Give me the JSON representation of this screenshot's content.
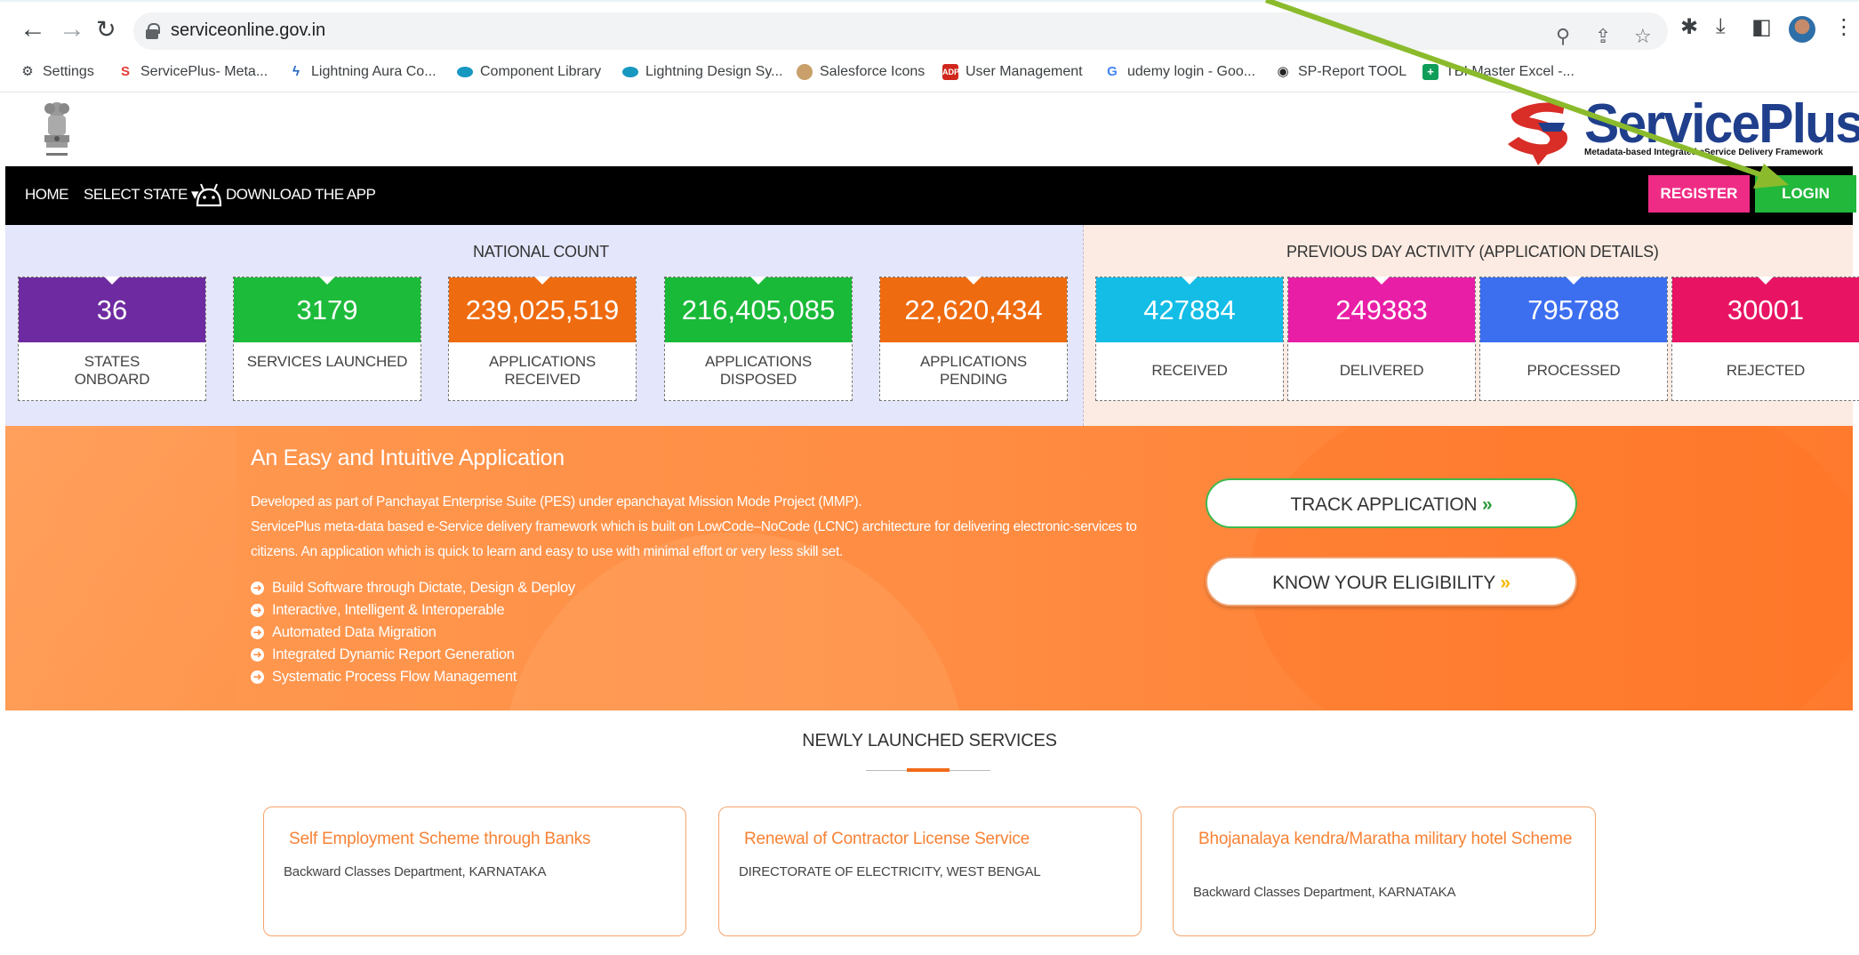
{
  "browser": {
    "url": "serviceonline.gov.in",
    "bookmarks": [
      {
        "label": "Settings",
        "icon": "gear-icon"
      },
      {
        "label": "ServicePlus- Meta...",
        "icon": "serviceplus-icon"
      },
      {
        "label": "Lightning Aura Co...",
        "icon": "lightning-icon"
      },
      {
        "label": "Component Library",
        "icon": "salesforce-cloud-icon"
      },
      {
        "label": "Lightning Design Sy...",
        "icon": "salesforce-cloud-icon"
      },
      {
        "label": "Salesforce Icons",
        "icon": "astro-icon"
      },
      {
        "label": "User Management",
        "icon": "adp-icon"
      },
      {
        "label": "udemy login - Goo...",
        "icon": "google-icon"
      },
      {
        "label": "SP-Report TOOL",
        "icon": "globe-icon"
      },
      {
        "label": "TBI Master Excel -...",
        "icon": "sheets-icon"
      }
    ]
  },
  "header": {
    "logo_text": "ServicePlus",
    "logo_tagline": "Metadata-based Integrated eService Delivery Framework"
  },
  "nav": {
    "home": "HOME",
    "select_state": "SELECT STATE",
    "download": "DOWNLOAD THE APP",
    "register": "REGISTER",
    "login": "LOGIN"
  },
  "national": {
    "title": "NATIONAL COUNT",
    "cards": [
      {
        "value": "36",
        "label1": "STATES",
        "label2": "ONBOARD",
        "color": "#6e2ba1"
      },
      {
        "value": "3179",
        "label1": "SERVICES LAUNCHED",
        "label2": "",
        "color": "#1dbb3a"
      },
      {
        "value": "239,025,519",
        "label1": "APPLICATIONS",
        "label2": "RECEIVED",
        "color": "#ef6b10"
      },
      {
        "value": "216,405,085",
        "label1": "APPLICATIONS",
        "label2": "DISPOSED",
        "color": "#1aba39"
      },
      {
        "value": "22,620,434",
        "label1": "APPLICATIONS",
        "label2": "PENDING",
        "color": "#ef6b10"
      }
    ]
  },
  "previous_day": {
    "title": "PREVIOUS DAY ACTIVITY (APPLICATION DETAILS)",
    "cards": [
      {
        "value": "427884",
        "label": "RECEIVED",
        "color": "#13bde6"
      },
      {
        "value": "249383",
        "label": "DELIVERED",
        "color": "#e81fa6"
      },
      {
        "value": "795788",
        "label": "PROCESSED",
        "color": "#3c6ef0"
      },
      {
        "value": "30001",
        "label": "REJECTED",
        "color": "#e81463"
      }
    ]
  },
  "banner": {
    "title": "An Easy and Intuitive Application",
    "para1": "Developed as part of Panchayat Enterprise Suite (PES) under epanchayat Mission Mode Project (MMP).",
    "para2": "ServicePlus meta-data based e-Service delivery framework which is built on LowCode–NoCode (LCNC) architecture for delivering electronic-services to citizens. An application which is quick to learn and easy to use with minimal effort or very less skill set.",
    "features": [
      "Build Software through Dictate, Design & Deploy",
      "Interactive, Intelligent & Interoperable",
      "Automated Data Migration",
      "Integrated Dynamic Report Generation",
      "Systematic Process Flow Management"
    ],
    "track_label": "TRACK APPLICATION",
    "eligibility_label": "KNOW YOUR ELIGIBILITY"
  },
  "newly_launched": {
    "title": "NEWLY LAUNCHED SERVICES",
    "services": [
      {
        "name": "Self Employment Scheme through Banks",
        "dept": "Backward Classes Department, KARNATAKA"
      },
      {
        "name": "Renewal of Contractor License Service",
        "dept": "DIRECTORATE OF ELECTRICITY, WEST BENGAL"
      },
      {
        "name": "Bhojanalaya kendra/Maratha military hotel Scheme",
        "dept": "Backward Classes Department, KARNATAKA"
      }
    ]
  }
}
